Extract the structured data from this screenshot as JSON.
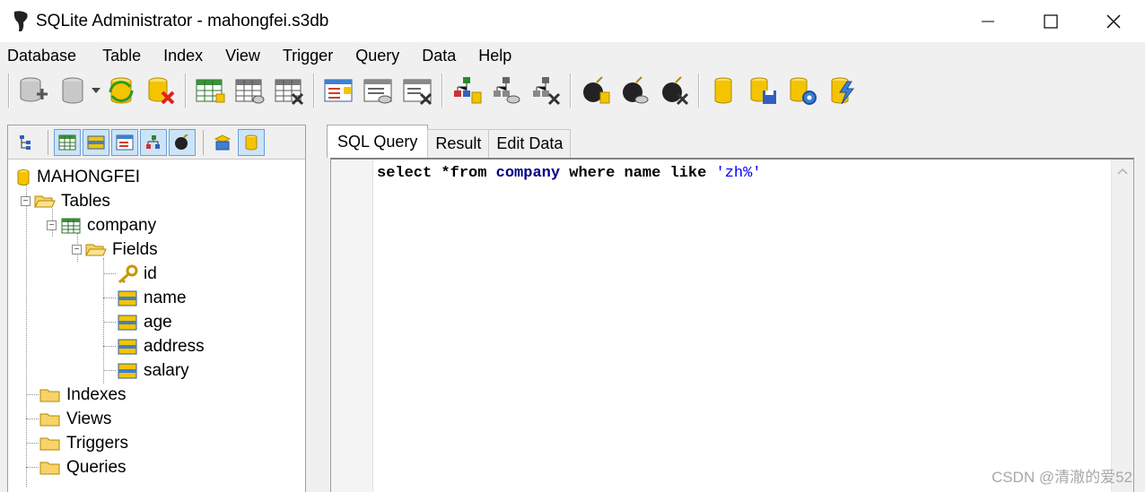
{
  "window": {
    "title": "SQLite Administrator - mahongfei.s3db"
  },
  "menu": [
    "Database",
    "Table",
    "Index",
    "View",
    "Trigger",
    "Query",
    "Data",
    "Help"
  ],
  "toolbar_icons": [
    "new-database-icon",
    "open-database-icon",
    "refresh-database-icon",
    "close-database-icon",
    "create-table-icon",
    "edit-table-icon",
    "delete-table-icon",
    "create-view-icon",
    "edit-view-icon",
    "delete-view-icon",
    "create-index-icon",
    "edit-index-icon",
    "delete-index-icon",
    "create-trigger-icon",
    "edit-trigger-icon",
    "delete-trigger-icon",
    "database-info-icon",
    "save-database-icon",
    "database-settings-icon",
    "execute-query-icon"
  ],
  "tree": {
    "root": "MAHONGFEI",
    "tables_label": "Tables",
    "table_name": "company",
    "fields_label": "Fields",
    "fields": [
      "id",
      "name",
      "age",
      "address",
      "salary"
    ],
    "indexes_label": "Indexes",
    "views_label": "Views",
    "triggers_label": "Triggers",
    "queries_label": "Queries"
  },
  "tabs": [
    "SQL Query",
    "Result",
    "Edit Data"
  ],
  "editor": {
    "kw_select": "select",
    "star_from": " *from ",
    "table": "company",
    "where_part": " where name like ",
    "pattern": "'zh%'"
  },
  "watermark": "CSDN @清澈的爱52"
}
